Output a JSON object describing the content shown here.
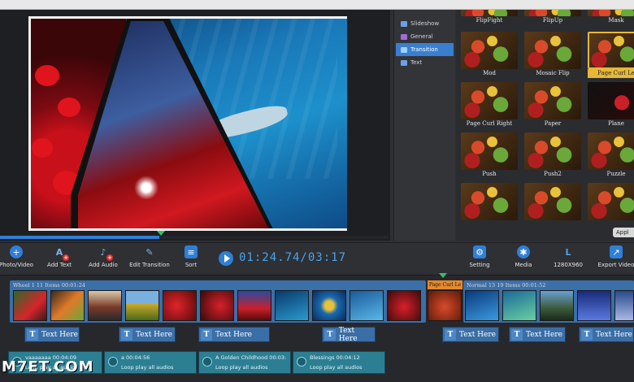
{
  "categories": [
    {
      "label": "Slideshow",
      "color": "#6aa0e6"
    },
    {
      "label": "General",
      "color": "#a66ad8"
    },
    {
      "label": "Transition",
      "color": "#6aa0e6"
    },
    {
      "label": "Text",
      "color": "#6aa0e6"
    }
  ],
  "active_category": "Transition",
  "transitions": [
    {
      "label": "FlipFight"
    },
    {
      "label": "FlipUp"
    },
    {
      "label": "Mask"
    },
    {
      "label": "Mod"
    },
    {
      "label": "Mosaic Flip"
    },
    {
      "label": "Page Curl Le"
    },
    {
      "label": "Page Curl Right"
    },
    {
      "label": "Paper"
    },
    {
      "label": "Plane"
    },
    {
      "label": "Push"
    },
    {
      "label": "Push2"
    },
    {
      "label": "Puzzle"
    }
  ],
  "selected_transition": "Page Curl Le",
  "apply_label": "Appl",
  "toolbar": {
    "photo_video": "Photo/Video",
    "add_text": "Add Text",
    "add_audio": "Add Audio",
    "edit_transition": "Edit Transition",
    "sort": "Sort",
    "timecode": "01:24.74/03:17",
    "setting": "Setting",
    "media": "Media",
    "resolution": "1280X960",
    "export_video": "Export Video"
  },
  "playback_progress": 0.41,
  "timeline": {
    "group1": "Wheel 1   11 Items   00:01:24",
    "transition_chip": "Page Curl Le",
    "group2": "Normal 13   19 Items   00:01:52",
    "text_chips": [
      "Text Here",
      "Text Here",
      "Text Here",
      "Text Here",
      "Text Here",
      "Text Here",
      "Text Here"
    ],
    "audio": [
      {
        "name": "vaaaaaaa   00:04:09",
        "sub": "Loop play all audios"
      },
      {
        "name": "a   00:04:56",
        "sub": "Loop play all audios"
      },
      {
        "name": "A Golden Childhood   00:03:",
        "sub": "Loop play all audios"
      },
      {
        "name": "Blessings   00:04:12",
        "sub": "Loop play all audios"
      }
    ]
  },
  "watermark": "M7ET.COM"
}
